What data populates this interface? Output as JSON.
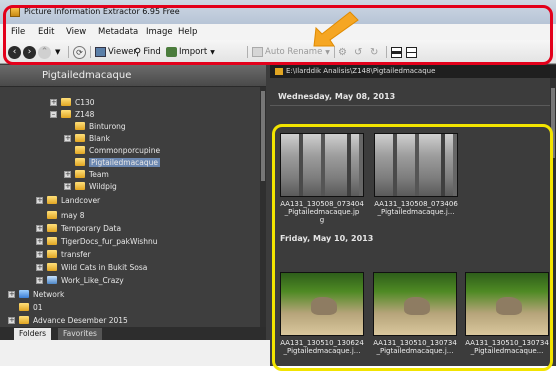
{
  "window": {
    "title": "Picture Information Extractor 6.95 Free"
  },
  "menu": [
    "File",
    "Edit",
    "View",
    "Metadata",
    "Image",
    "Help"
  ],
  "toolbar": {
    "viewer": "Viewer",
    "find": "Find",
    "import": "Import",
    "auto_rename": "Auto Rename"
  },
  "left_panel": {
    "header": "Pigtailedmacaque",
    "tree": [
      {
        "label": "C130",
        "level": 3,
        "expander": "+"
      },
      {
        "label": "Z148",
        "level": 3,
        "expander": "-"
      },
      {
        "label": "Binturong",
        "level": 4,
        "expander": ""
      },
      {
        "label": "Blank",
        "level": 4,
        "expander": "+"
      },
      {
        "label": "Commonporcupine",
        "level": 4,
        "expander": ""
      },
      {
        "label": "Pigtailedmacaque",
        "level": 4,
        "expander": "",
        "selected": true
      },
      {
        "label": "Team",
        "level": 4,
        "expander": "+"
      },
      {
        "label": "Wildpig",
        "level": 4,
        "expander": "+"
      },
      {
        "label": "Landcover",
        "level": 2,
        "expander": "+"
      },
      {
        "label": "may 8",
        "level": 2,
        "expander": ""
      },
      {
        "label": "Temporary Data",
        "level": 2,
        "expander": "+"
      },
      {
        "label": "TigerDocs_fur_pakWishnu",
        "level": 2,
        "expander": "+"
      },
      {
        "label": "transfer",
        "level": 2,
        "expander": "+"
      },
      {
        "label": "Wild Cats in Bukit Sosa",
        "level": 2,
        "expander": "+"
      },
      {
        "label": "Work_Like_Crazy",
        "level": 2,
        "expander": "+",
        "icon": "computer"
      },
      {
        "label": "Network",
        "level": 0,
        "expander": "+",
        "icon": "network"
      },
      {
        "label": "01",
        "level": 0,
        "expander": "",
        "icon": "folder"
      },
      {
        "label": "Advance Desember 2015",
        "level": 0,
        "expander": "+",
        "icon": "folder"
      }
    ],
    "tabs": [
      "Folders",
      "Favorites"
    ]
  },
  "right_panel": {
    "path": "E:\\Ilarddik Analisis\\Z148\\Pigtailedmacaque",
    "groups": [
      {
        "date": "Wednesday, May 08, 2013",
        "items": [
          {
            "caption": [
              "AA131_130508_073404",
              "_Pigtailedmacaque.jp",
              "g"
            ]
          },
          {
            "caption": [
              "AA131_130508_073406",
              "_Pigtailedmacaque.j..."
            ]
          }
        ]
      },
      {
        "date": "Friday, May 10, 2013",
        "items": [
          {
            "caption": [
              "AA131_130510_130624",
              "_Pigtailedmacaque.j..."
            ]
          },
          {
            "caption": [
              "AA131_130510_130734",
              "_Pigtailedmacaque.j..."
            ]
          },
          {
            "caption": [
              "AA131_130510_130734",
              "_Pigtailedmacaque..."
            ]
          }
        ]
      }
    ]
  },
  "colors": {
    "highlight_red": "#e3001b",
    "highlight_yellow": "#f2e400",
    "arrow": "#f5a623"
  }
}
